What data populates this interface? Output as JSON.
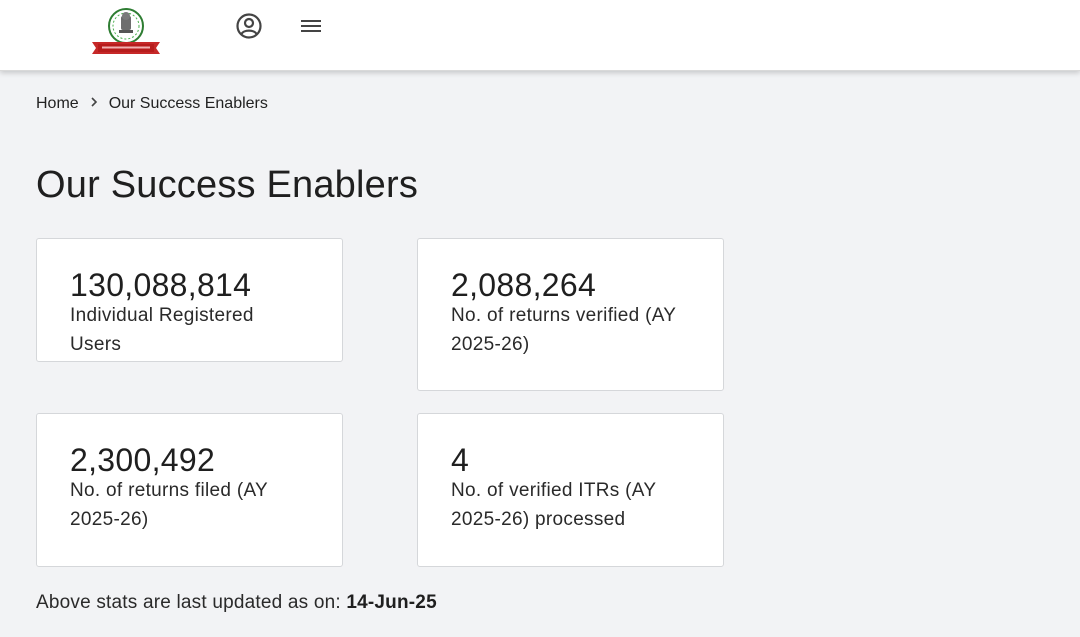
{
  "header": {
    "logo_alt": "Income Tax Department",
    "icons": [
      "account-icon",
      "menu-icon"
    ],
    "logo_colors": {
      "ribbon": "#c62828",
      "emblem": "#2e7d32"
    }
  },
  "breadcrumb": {
    "home": "Home",
    "current": "Our Success Enablers"
  },
  "page": {
    "title": "Our Success Enablers"
  },
  "stats": [
    {
      "value": "130,088,814",
      "label": "Individual Registered Users"
    },
    {
      "value": "2,088,264",
      "label": "No. of returns verified (AY 2025-26)"
    },
    {
      "value": "2,300,492",
      "label": "No. of returns filed (AY 2025-26)"
    },
    {
      "value": "4",
      "label": "No. of verified ITRs (AY 2025-26) processed"
    }
  ],
  "footer": {
    "note": "Above stats are last updated as on: ",
    "date": "14-Jun-25"
  }
}
